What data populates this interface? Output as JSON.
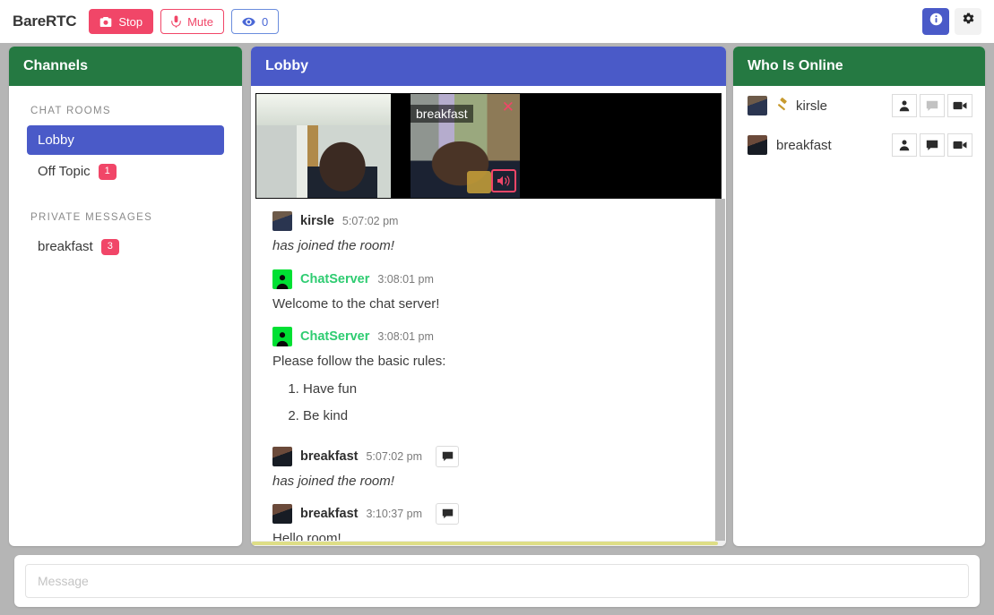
{
  "app": {
    "brand": "BareRTC",
    "stop_label": "Stop",
    "mute_label": "Mute",
    "viewers_count": "0",
    "info_icon": "info-icon",
    "gear_icon": "gear-icon",
    "camera_icon": "camera-icon",
    "microphone_icon": "microphone-icon",
    "eye_icon": "eye-icon",
    "colors": {
      "page_bg": "#b5b5b5",
      "header_green": "#257942",
      "header_blue": "#4a5ac8",
      "danger": "#f14668",
      "server_name": "#2ecc71",
      "badge": "#f14668"
    }
  },
  "sidebar": {
    "title": "Channels",
    "sections": [
      {
        "label": "CHAT ROOMS",
        "items": [
          {
            "name": "Lobby",
            "badge": "",
            "active": true
          },
          {
            "name": "Off Topic",
            "badge": "1",
            "active": false
          }
        ]
      },
      {
        "label": "PRIVATE MESSAGES",
        "items": [
          {
            "name": "breakfast",
            "badge": "3",
            "active": false
          }
        ]
      }
    ]
  },
  "chat": {
    "title": "Lobby",
    "videos": [
      {
        "name": "",
        "self": true,
        "close_icon": "",
        "speaker_icon": ""
      },
      {
        "name": "breakfast",
        "self": false,
        "close_icon": "close-icon",
        "speaker_icon": "speaker-icon"
      }
    ],
    "messages": [
      {
        "author": "kirsle",
        "time": "5:07:02 pm",
        "body": "has joined the room!",
        "italic": true,
        "server": false,
        "has_action": false,
        "avatar": "k"
      },
      {
        "author": "ChatServer",
        "time": "3:08:01 pm",
        "body": "Welcome to the chat server!",
        "italic": false,
        "server": true,
        "has_action": false,
        "avatar": "server"
      },
      {
        "author": "ChatServer",
        "time": "3:08:01 pm",
        "body": "Please follow the basic rules:",
        "italic": false,
        "server": true,
        "has_action": false,
        "avatar": "server",
        "list": [
          "Have fun",
          "Be kind"
        ]
      },
      {
        "author": "breakfast",
        "time": "5:07:02 pm",
        "body": "has joined the room!",
        "italic": true,
        "server": false,
        "has_action": true,
        "avatar": "b"
      },
      {
        "author": "breakfast",
        "time": "3:10:37 pm",
        "body": "Hello room!",
        "italic": false,
        "server": false,
        "has_action": true,
        "avatar": "b"
      }
    ]
  },
  "online": {
    "title": "Who Is Online",
    "users": [
      {
        "name": "kirsle",
        "op": true,
        "op_icon": "gavel-icon",
        "avatar": "k",
        "actions": [
          {
            "icon": "person-icon",
            "disabled": false
          },
          {
            "icon": "chat-bubble-icon",
            "disabled": true
          },
          {
            "icon": "video-camera-icon",
            "disabled": false
          }
        ]
      },
      {
        "name": "breakfast",
        "op": false,
        "op_icon": "",
        "avatar": "b",
        "actions": [
          {
            "icon": "person-icon",
            "disabled": false
          },
          {
            "icon": "chat-bubble-icon",
            "disabled": false
          },
          {
            "icon": "video-camera-icon",
            "disabled": false
          }
        ]
      }
    ]
  },
  "composer": {
    "placeholder": "Message",
    "value": ""
  }
}
